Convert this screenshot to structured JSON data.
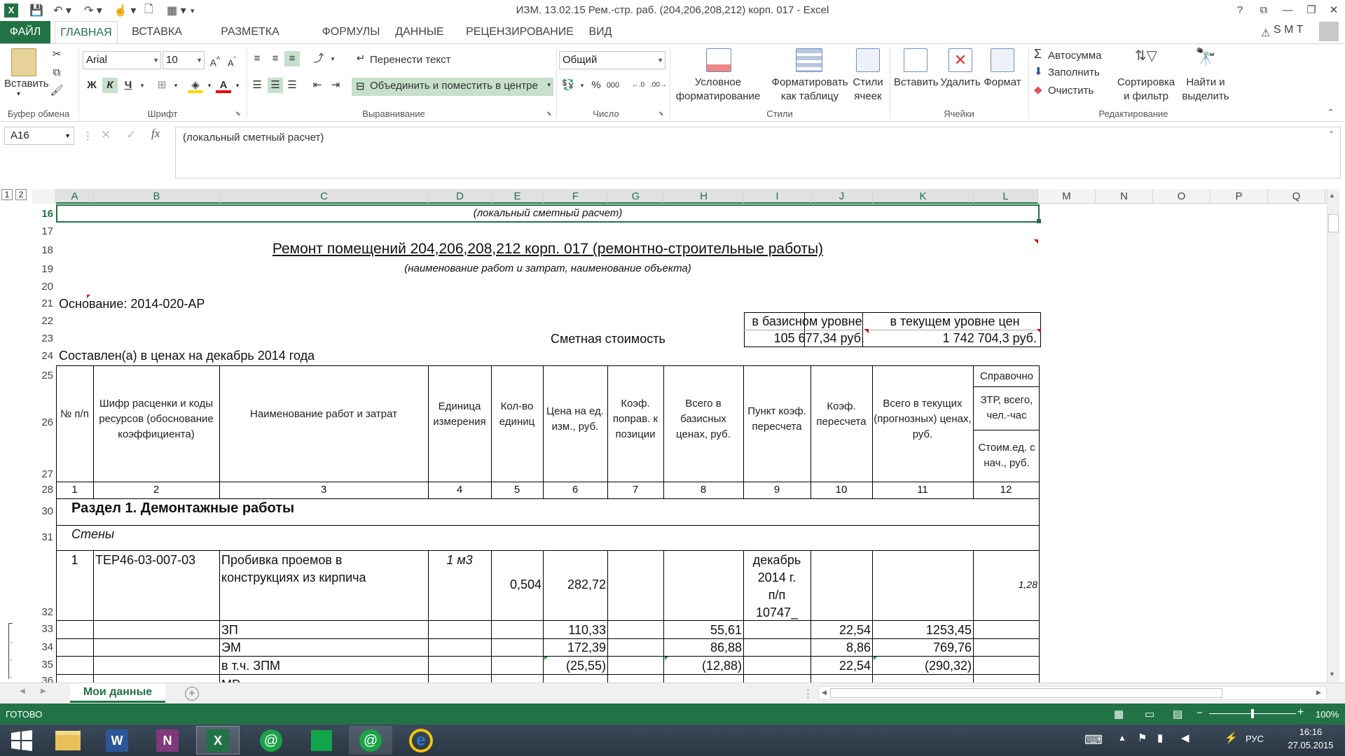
{
  "window": {
    "title": "ИЗМ. 13.02.15 Рем.-стр. раб.  (204,206,208,212) корп. 017 - Excel",
    "user": "S M T",
    "help": "?"
  },
  "menu_tabs": [
    "ФАЙЛ",
    "ГЛАВНАЯ",
    "ВСТАВКА",
    "РАЗМЕТКА СТРАНИЦЫ",
    "ФОРМУЛЫ",
    "ДАННЫЕ",
    "РЕЦЕНЗИРОВАНИЕ",
    "ВИД"
  ],
  "ribbon": {
    "clipboard": {
      "paste": "Вставить",
      "label": "Буфер обмена"
    },
    "font": {
      "name": "Arial",
      "size": "10",
      "bold": "Ж",
      "italic": "К",
      "underline": "Ч",
      "label": "Шрифт"
    },
    "alignment": {
      "wrap": "Перенести текст",
      "merge": "Объединить и поместить в центре",
      "label": "Выравнивание"
    },
    "number": {
      "format": "Общий",
      "pct": "%",
      "thousands": "000",
      "label": "Число"
    },
    "styles": {
      "conditional": "Условное",
      "conditional2": "форматирование",
      "table": "Форматировать",
      "table2": "как таблицу",
      "cell": "Стили",
      "cell2": "ячеек",
      "label": "Стили"
    },
    "cells": {
      "insert": "Вставить",
      "delete": "Удалить",
      "format": "Формат",
      "label": "Ячейки"
    },
    "editing": {
      "autosum": "Автосумма",
      "fill": "Заполнить",
      "clear": "Очистить",
      "sort": "Сортировка",
      "sort2": "и фильтр",
      "find": "Найти и",
      "find2": "выделить",
      "label": "Редактирование"
    }
  },
  "formula_bar": {
    "name_box": "A16",
    "fx": "fx",
    "content": "(локальный сметный расчет)"
  },
  "outline_levels": [
    "1",
    "2"
  ],
  "columns": [
    "A",
    "B",
    "C",
    "D",
    "E",
    "F",
    "G",
    "H",
    "I",
    "J",
    "K",
    "L",
    "M",
    "N",
    "O",
    "P",
    "Q"
  ],
  "rows": [
    "16",
    "17",
    "18",
    "19",
    "20",
    "21",
    "22",
    "23",
    "24",
    "25",
    "26",
    "27",
    "28",
    "30",
    "31",
    "32",
    "33",
    "34",
    "35",
    "36"
  ],
  "sheet": {
    "r16": "(локальный сметный расчет)",
    "r18": "Ремонт помещений  204,206,208,212 корп. 017  (ремонтно-строительные работы)",
    "r19": "(наименование работ и затрат, наименование объекта)",
    "r21": "Основание: 2014-020-АР",
    "r22_base": "в базисном уровне",
    "r22_cur": "в текущем уровне цен",
    "r23_label": "Сметная стоимость",
    "r23_base": "105 677,34 руб.",
    "r23_cur": "1 742 704,3 руб.",
    "r24": "Составлен(а) в ценах на декабрь 2014 года",
    "headers": {
      "a": "№ п/п",
      "b": "Шифр расценки и коды ресурсов (обоснование коэффициента)",
      "c": "Наименование работ и затрат",
      "d": "Единица измерения",
      "e": "Кол-во единиц",
      "f": "Цена на ед. изм., руб.",
      "g": "Коэф. поправ. к позиции",
      "h": "Всего в базисных ценах, руб.",
      "i": "Пункт коэф. пересчета",
      "j": "Коэф. пересчета",
      "k": "Всего в текущих (прогнозных) ценах, руб.",
      "l_top": "Справочно",
      "l_mid": "ЗТР, всего, чел.-час",
      "l_bot": "Стоим.ед. с нач., руб."
    },
    "nums": [
      "1",
      "2",
      "3",
      "4",
      "5",
      "6",
      "7",
      "8",
      "9",
      "10",
      "11",
      "12"
    ],
    "section": "Раздел 1. Демонтажные работы",
    "subsection": "Стены",
    "item": {
      "n": "1",
      "code": "ТЕР46-03-007-03",
      "name1": "Пробивка проемов в",
      "name2": "конструкциях из кирпича",
      "unit": "1 м3",
      "qty": "0,504",
      "price": "282,72",
      "pt1": "декабрь",
      "pt2": "2014 г.",
      "pt3": "п/п",
      "pt4": "10747_",
      "l": "1,28"
    },
    "r33": {
      "c": "ЗП",
      "f": "110,33",
      "h": "55,61",
      "j": "22,54",
      "k": "1253,45"
    },
    "r34": {
      "c": "ЭМ",
      "f": "172,39",
      "h": "86,88",
      "j": "8,86",
      "k": "769,76"
    },
    "r35": {
      "c": "в т.ч. ЗПМ",
      "f": "(25,55)",
      "h": "(12,88)",
      "j": "22,54",
      "k": "(290,32)"
    },
    "r36": {
      "c": "МР"
    }
  },
  "sheet_tabs": {
    "active": "Мои данные",
    "add": "+"
  },
  "status": {
    "ready": "ГОТОВО",
    "zoom": "100%"
  },
  "taskbar": {
    "lang": "РУС",
    "time": "16:16",
    "date": "27.05.2015"
  }
}
